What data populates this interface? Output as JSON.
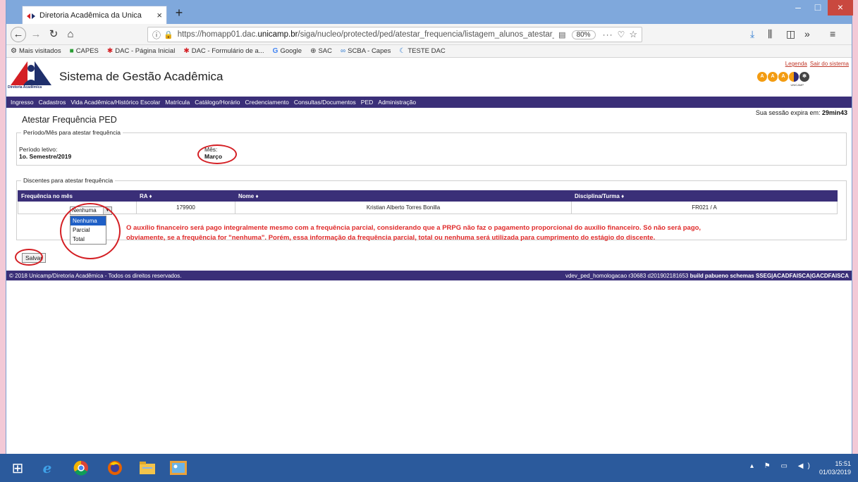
{
  "browser": {
    "tab_title": "Diretoria Acadêmica da Unica",
    "tab_close": "×",
    "new_tab": "+",
    "url_prefix": "https://homapp01.dac.",
    "url_domain": "unicamp.br",
    "url_path": "/siga/nucleo/protected/ped/atestar_frequencia/listagem_alunos_atestar_frequencia.x",
    "zoom": "80%",
    "window_controls": {
      "minimize": "–",
      "maximize": "□",
      "close": "×"
    },
    "bookmarks": [
      {
        "label": "Mais visitados",
        "icon": "gear-icon"
      },
      {
        "label": "CAPES",
        "icon": "capes-icon"
      },
      {
        "label": "DAC - Página Inicial",
        "icon": "dac-icon"
      },
      {
        "label": "DAC - Formulário de a...",
        "icon": "dac-icon"
      },
      {
        "label": "Google",
        "icon": "google-icon"
      },
      {
        "label": "SAC",
        "icon": "globe-icon"
      },
      {
        "label": "SCBA - Capes",
        "icon": "scba-icon"
      },
      {
        "label": "TESTE DAC",
        "icon": "teste-icon"
      }
    ]
  },
  "header": {
    "app_title": "Sistema de Gestão Acadêmica",
    "logo_sub": "Diretoria Acadêmica",
    "links": {
      "legenda": "Legenda",
      "sair": "Sair do sistema"
    },
    "unicamp_text": "UNICAMP"
  },
  "menu": [
    "Ingresso",
    "Cadastros",
    "Vida Acadêmica/Histórico Escolar",
    "Matrícula",
    "Catálogo/Horário",
    "Credenciamento",
    "Consultas/Documentos",
    "PED",
    "Administração"
  ],
  "page": {
    "title": "Atestar Frequência PED",
    "session_label": "Sua sessão expira em:",
    "session_time": "29min43",
    "periodo_legend": "Período/Mês para atestar frequência",
    "periodo_label": "Período letivo:",
    "periodo_value": "1o. Semestre/2019",
    "mes_label": "Mês:",
    "mes_value": "Março",
    "discentes_legend": "Discentes para atestar frequência",
    "table": {
      "headers": [
        "Frequência no mês",
        "RA ♦",
        "Nome ♦",
        "Disciplina/Turma ♦"
      ],
      "row": {
        "ra": "179900",
        "nome": "Kristian Alberto Torres Bonilla",
        "disciplina": "FR021 / A"
      }
    },
    "select": {
      "value": "Nenhuma",
      "options": [
        "Nenhuma",
        "Parcial",
        "Total"
      ]
    },
    "warning_line1": "O auxílio financeiro será pago integralmente mesmo com a frequência parcial, considerando que a PRPG não faz o pagamento proporcional do auxílio financeiro. Só não será pago,",
    "warning_line2": "obviamente, se a frequência for \"nenhuma\". Porém, essa informação da frequência parcial, total ou nenhuma será utilizada para cumprimento do estágio do discente.",
    "save_label": "Salvar"
  },
  "footer": {
    "left": "© 2018 Unicamp/Diretoria Acadêmica - Todos os direitos reservados.",
    "right_plain": "vdev_ped_homologacao r30683 d201902181653",
    "right_bold": "build pabueno schemas SSEG|ACADFAISCA|GACDFAISCA"
  },
  "taskbar": {
    "time": "15:51",
    "date": "01/03/2019"
  },
  "colors": {
    "menu_bg": "#3a2f78",
    "warning": "#e02a2a",
    "annotation": "#d41f24",
    "taskbar": "#2b5a9c"
  }
}
